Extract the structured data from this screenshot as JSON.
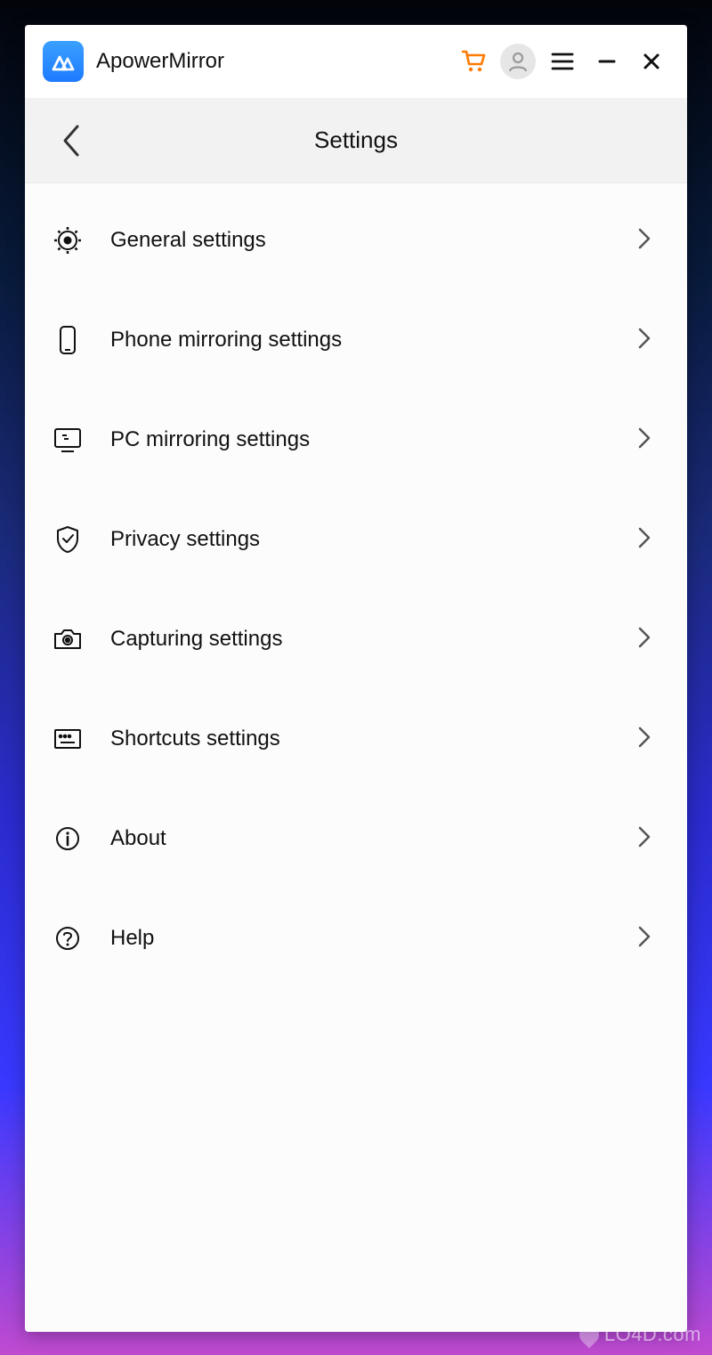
{
  "app": {
    "title": "ApowerMirror",
    "logoColor": "#2a87ff"
  },
  "header": {
    "title": "Settings"
  },
  "menu": {
    "items": [
      {
        "icon": "gear-icon",
        "label": "General settings"
      },
      {
        "icon": "phone-icon",
        "label": "Phone mirroring settings"
      },
      {
        "icon": "monitor-icon",
        "label": "PC mirroring settings"
      },
      {
        "icon": "shield-icon",
        "label": "Privacy settings"
      },
      {
        "icon": "camera-icon",
        "label": "Capturing settings"
      },
      {
        "icon": "keyboard-icon",
        "label": "Shortcuts settings"
      },
      {
        "icon": "info-icon",
        "label": "About"
      },
      {
        "icon": "help-icon",
        "label": "Help"
      }
    ]
  },
  "watermark": {
    "text": "LO4D.com"
  },
  "colors": {
    "cartAccent": "#ff7a00"
  }
}
